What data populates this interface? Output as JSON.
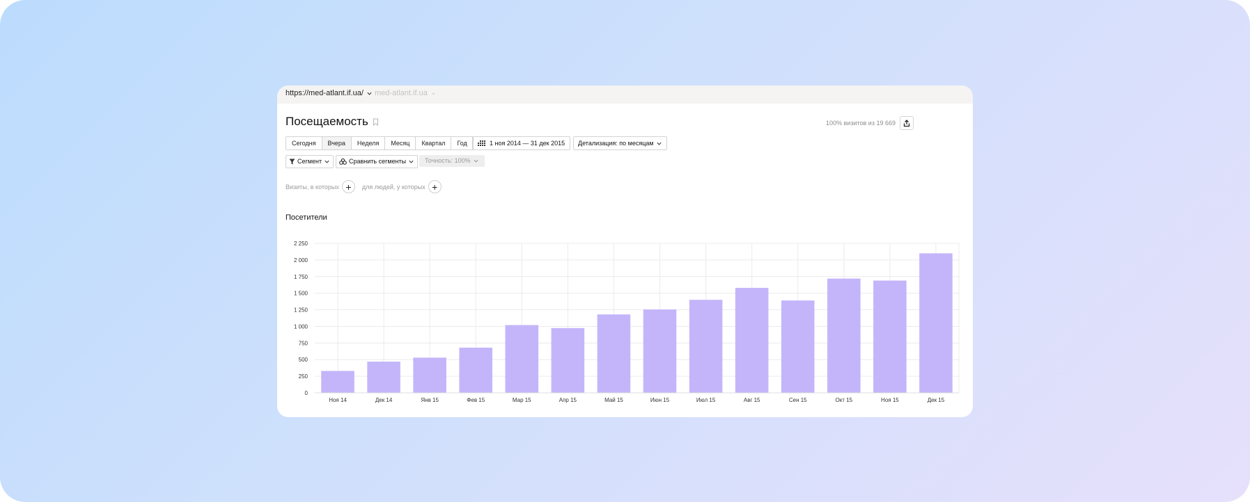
{
  "header": {
    "url": "https://med-atlant.if.ua/",
    "url_secondary": "med-atlant.if.ua"
  },
  "report": {
    "title": "Посещаемость",
    "share_info": "100% визитов из 19 669"
  },
  "period_tabs": [
    {
      "label": "Сегодня",
      "active": false
    },
    {
      "label": "Вчера",
      "active": true
    },
    {
      "label": "Неделя",
      "active": false
    },
    {
      "label": "Месяц",
      "active": false
    },
    {
      "label": "Квартал",
      "active": false
    },
    {
      "label": "Год",
      "active": false
    }
  ],
  "date_range": "1 ноя 2014 — 31 дек 2015",
  "detail": "Детализация: по месяцам",
  "segment_label": "Сегмент",
  "compare_label": "Сравнить сегменты",
  "accuracy_label": "Точность: 100%",
  "filters": {
    "visits_label": "Визиты, в которых",
    "people_label": "для людей, у которых"
  },
  "section_title": "Посетители",
  "colors": {
    "bar": "#c4b5fa",
    "grid": "#ebebeb",
    "background_start": "#bcdcfd",
    "background_end": "#e6e0fb"
  },
  "chart_data": {
    "type": "bar",
    "categories": [
      "Ноя 14",
      "Дек 14",
      "Янв 15",
      "Фев 15",
      "Мар 15",
      "Апр 15",
      "Май 15",
      "Июн 15",
      "Июл 15",
      "Авг 15",
      "Сен 15",
      "Окт 15",
      "Ноя 15",
      "Дек 15"
    ],
    "values": [
      330,
      470,
      530,
      680,
      1020,
      975,
      1180,
      1255,
      1400,
      1580,
      1390,
      1720,
      1690,
      2100
    ],
    "ylim": [
      0,
      2250
    ],
    "yticks": [
      0,
      250,
      500,
      750,
      1000,
      1250,
      1500,
      1750,
      2000,
      2250
    ],
    "ytick_labels": [
      "0",
      "250",
      "500",
      "750",
      "1 000",
      "1 250",
      "1 500",
      "1 750",
      "2 000",
      "2 250"
    ],
    "grid": true
  }
}
